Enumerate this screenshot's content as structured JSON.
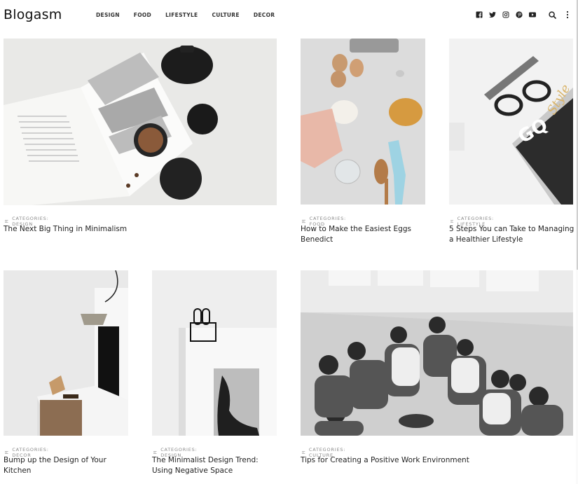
{
  "header": {
    "logo": "Blogasm",
    "nav": [
      "DESIGN",
      "FOOD",
      "LIFESTYLE",
      "CULTURE",
      "DECOR"
    ],
    "social_icons": [
      "facebook-icon",
      "twitter-icon",
      "instagram-icon",
      "pinterest-icon",
      "youtube-icon"
    ],
    "search_icon": "search-icon",
    "more_icon": "more-vertical-icon"
  },
  "posts": [
    {
      "category": "CATEGORIES: DESIGN",
      "title": "The Next Big Thing in Minimalism",
      "image": "open magazine with teapot, bowl of nuts and black sphere"
    },
    {
      "category": "CATEGORIES: FOOD",
      "title": "How to Make the Easiest Eggs Benedict",
      "image": "eggs, flour, honey and kitchen utensils"
    },
    {
      "category": "CATEGORIES: LIFESTYLE",
      "title": "5 Steps You can Take to Managing a Healthier Lifestyle",
      "image": "glasses, pen and GQ Style magazine"
    },
    {
      "category": "CATEGORIES: DECOR",
      "title": "Bump up the Design of Your Kitchen",
      "image": "white kitchen with pendant lamp"
    },
    {
      "category": "CATEGORIES: DESIGN",
      "title": "The Minimalist Design Trend: Using Negative Space",
      "image": "open magazine with binder clip"
    },
    {
      "category": "CATEGORIES: CULTURE",
      "title": "Tips for Creating a Positive Work Environment",
      "image": "team stacking hands in a circle"
    }
  ]
}
